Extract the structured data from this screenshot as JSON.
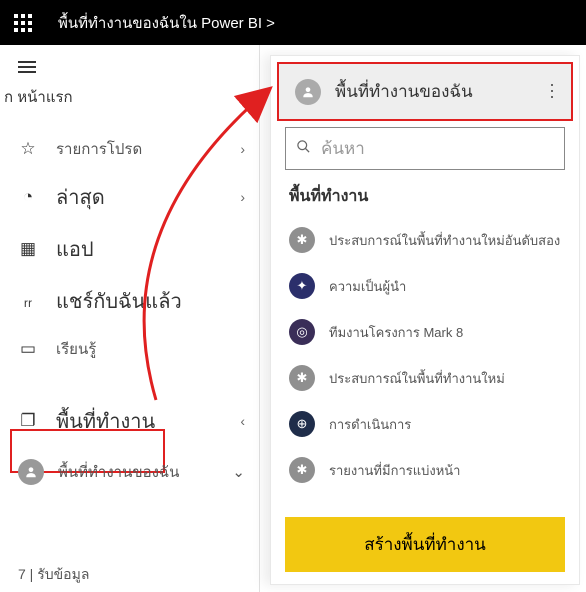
{
  "topbar": {
    "breadcrumb": "พื้นที่ทำงานของฉันใน Power BI >"
  },
  "nav": {
    "home": "ก หน้าแรก",
    "favorites": "รายการโปรด",
    "recent": "ล่าสุด",
    "apps": "แอป",
    "shared": "แชร์กับฉันแล้ว",
    "learn": "เรียนรู้",
    "workspaces": "พื้นที่ทำงาน",
    "my_workspace": "พื้นที่ทำงานของฉัน"
  },
  "footer": {
    "get_data": "7 | รับข้อมูล"
  },
  "panel": {
    "header": "พื้นที่ทำงานของฉัน",
    "search_placeholder": "ค้นหา",
    "section": "พื้นที่ทำงาน",
    "items": [
      {
        "label": "ประสบการณ์ในพื้นที่ทำงานใหม่อันดับสอง",
        "bg": "#8f8f8f",
        "glyph": "✱"
      },
      {
        "label": "ความเป็นผู้นำ",
        "bg": "#2b2f6b",
        "glyph": "✦"
      },
      {
        "label": "ทีมงานโครงการ Mark 8",
        "bg": "#3a2e58",
        "glyph": "◎"
      },
      {
        "label": "ประสบการณ์ในพื้นที่ทำงานใหม่",
        "bg": "#8f8f8f",
        "glyph": "✱"
      },
      {
        "label": "การดำเนินการ",
        "bg": "#1f2d4a",
        "glyph": "⊕"
      },
      {
        "label": "รายงานที่มีการแบ่งหน้า",
        "bg": "#8f8f8f",
        "glyph": "✱"
      }
    ],
    "create": "สร้างพื้นที่ทำงาน"
  }
}
